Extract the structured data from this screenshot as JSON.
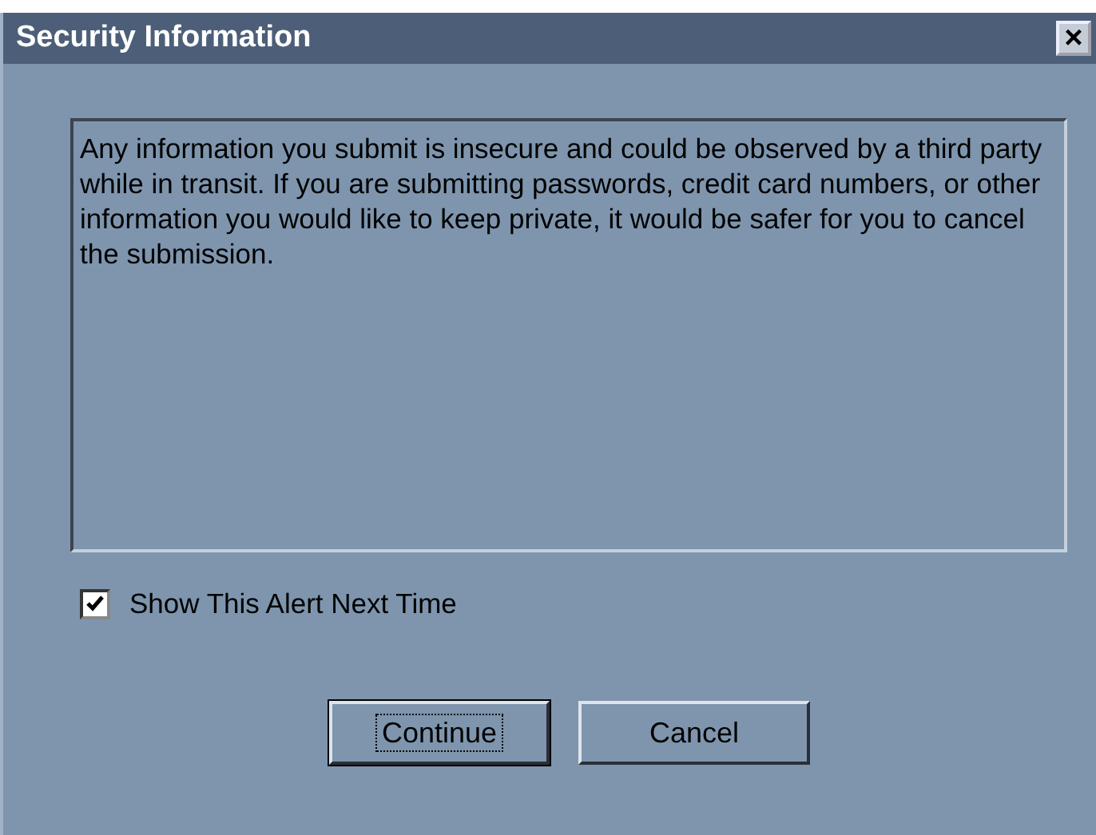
{
  "window": {
    "title": "Security Information",
    "close": "×"
  },
  "message": "Any information you submit is insecure and could be observed by a third party while in transit. If you are submitting passwords, credit card numbers, or other information you would like to keep private, it would be safer for you to cancel the submission.",
  "checkbox": {
    "label": "Show This Alert Next Time",
    "checked": true
  },
  "buttons": [
    {
      "label": "Continue",
      "selected": true
    },
    {
      "label": "Cancel",
      "selected": false
    }
  ]
}
